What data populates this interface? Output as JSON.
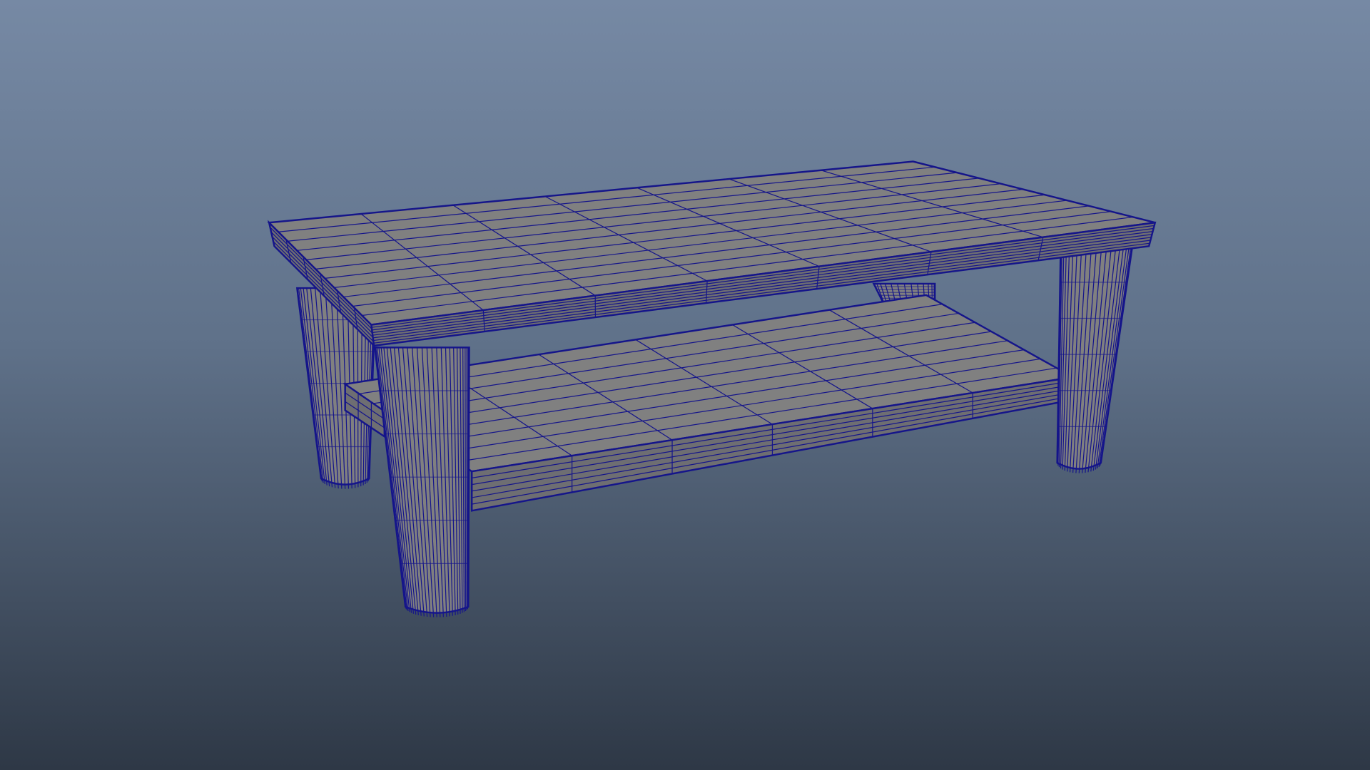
{
  "viewport": {
    "model": "coffee-table-wireframe",
    "colors": {
      "background_top": "#7689a4",
      "background_bottom": "#2e3846",
      "mesh_fill": "#808080",
      "mesh_side": "#6e6e72",
      "wireframe": "#15158a"
    }
  }
}
